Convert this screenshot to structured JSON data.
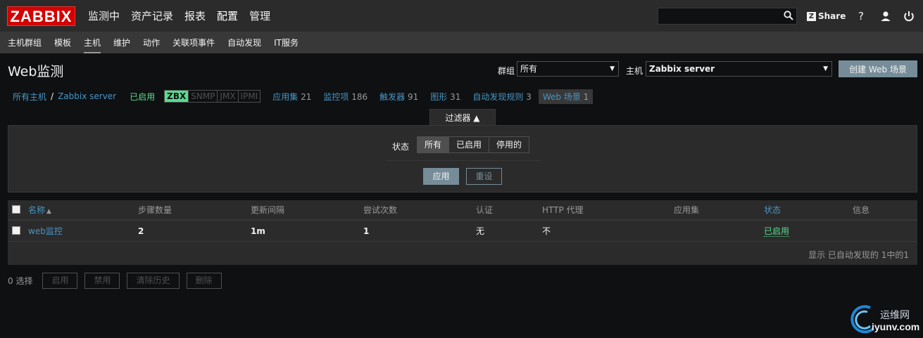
{
  "logo": "ZABBIX",
  "main_nav": [
    "监测中",
    "资产记录",
    "报表",
    "配置",
    "管理"
  ],
  "top_right": {
    "share_label": "Share",
    "help": "?",
    "share_z": "Z"
  },
  "sub_nav": [
    "主机群组",
    "模板",
    "主机",
    "维护",
    "动作",
    "关联项事件",
    "自动发现",
    "IT服务"
  ],
  "page": {
    "title": "Web监测",
    "group_label": "群组",
    "group_value": "所有",
    "host_label": "主机",
    "host_value": "Zabbix server",
    "create_button": "创建 Web 场景"
  },
  "breadcrumb": {
    "all_hosts": "所有主机",
    "sep": "/",
    "host": "Zabbix server",
    "status": "已启用",
    "tags": [
      "ZBX",
      "SNMP",
      "JMX",
      "IPMI"
    ],
    "items": [
      {
        "label": "应用集",
        "count": "21"
      },
      {
        "label": "监控项",
        "count": "186"
      },
      {
        "label": "触发器",
        "count": "91"
      },
      {
        "label": "图形",
        "count": "31"
      },
      {
        "label": "自动发现规则",
        "count": "3"
      },
      {
        "label": "Web 场景",
        "count": "1"
      }
    ]
  },
  "filter": {
    "tab_label": "过滤器 ▲",
    "status_label": "状态",
    "options": [
      "所有",
      "已启用",
      "停用的"
    ],
    "apply": "应用",
    "reset": "重设"
  },
  "table": {
    "headers": [
      "名称",
      "步骤数量",
      "更新间隔",
      "尝试次数",
      "认证",
      "HTTP 代理",
      "应用集",
      "状态",
      "信息"
    ],
    "sort_indicator": "▲",
    "rows": [
      {
        "name": "web监控",
        "steps": "2",
        "interval": "1m",
        "attempts": "1",
        "auth": "无",
        "proxy": "不",
        "apps": "",
        "status": "已启用",
        "info": ""
      }
    ],
    "footer": "显示 已自动发现的 1中的1"
  },
  "actions": {
    "selected": "0 选择",
    "buttons": [
      "启用",
      "禁用",
      "清除历史",
      "删除"
    ]
  },
  "watermark": {
    "text_cn": "运维网",
    "text_url": "iyunv.com"
  }
}
